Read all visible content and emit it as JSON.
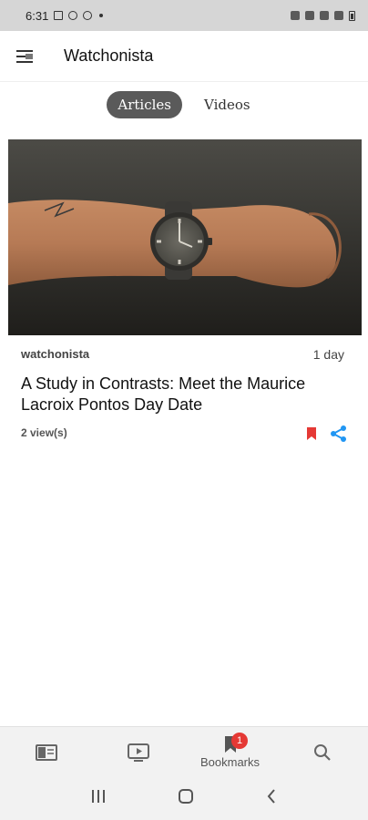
{
  "status_bar": {
    "time": "6:31"
  },
  "app_bar": {
    "title": "Watchonista"
  },
  "tabs": [
    {
      "label": "Articles",
      "active": true
    },
    {
      "label": "Videos",
      "active": false
    }
  ],
  "article": {
    "source": "watchonista",
    "time_ago": "1 day",
    "title": "A Study in Contrasts: Meet the Maurice Lacroix Pontos Day Date",
    "views": "2 view(s)"
  },
  "bottom_nav": {
    "items": [
      {
        "name": "articles",
        "label": "",
        "icon": "article-icon"
      },
      {
        "name": "videos",
        "label": "",
        "icon": "video-icon"
      },
      {
        "name": "bookmarks",
        "label": "Bookmarks",
        "icon": "bookmark-icon",
        "badge": "1"
      },
      {
        "name": "search",
        "label": "",
        "icon": "search-icon"
      }
    ]
  },
  "colors": {
    "accent_red": "#e53935",
    "share_blue": "#2196f3",
    "tab_active": "#5a5a5a"
  }
}
